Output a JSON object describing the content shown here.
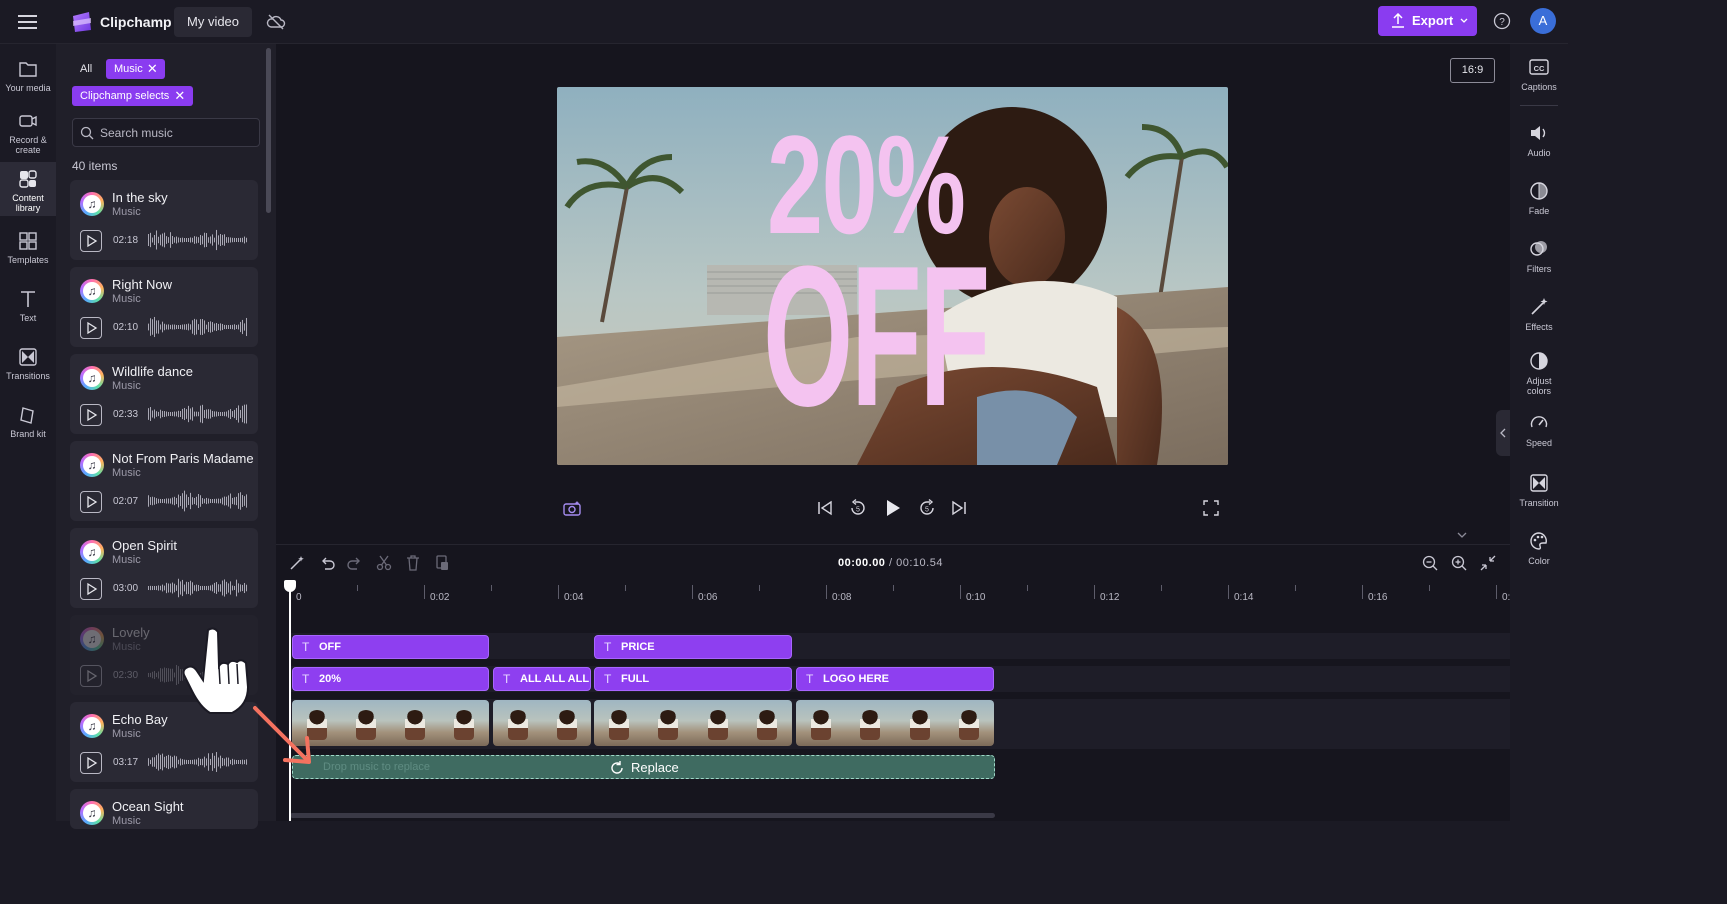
{
  "app": {
    "name": "Clipchamp",
    "project_title": "My video",
    "export_label": "Export",
    "avatar_initial": "A",
    "aspect_ratio": "16:9"
  },
  "left_rail": [
    {
      "label": "Your media",
      "icon": "folder-icon"
    },
    {
      "label": "Record & create",
      "icon": "camera-icon"
    },
    {
      "label": "Content library",
      "icon": "content-library-icon"
    },
    {
      "label": "Templates",
      "icon": "templates-icon"
    },
    {
      "label": "Text",
      "icon": "text-icon"
    },
    {
      "label": "Transitions",
      "icon": "transitions-icon"
    },
    {
      "label": "Brand kit",
      "icon": "brand-kit-icon"
    }
  ],
  "library": {
    "filters": {
      "all": "All",
      "music": "Music",
      "selects": "Clipchamp selects"
    },
    "search_placeholder": "Search music",
    "count": "40 items",
    "items": [
      {
        "title": "In the sky",
        "type": "Music",
        "duration": "02:18"
      },
      {
        "title": "Right Now",
        "type": "Music",
        "duration": "02:10"
      },
      {
        "title": "Wildlife dance",
        "type": "Music",
        "duration": "02:33"
      },
      {
        "title": "Not From Paris Madame",
        "type": "Music",
        "duration": "02:07"
      },
      {
        "title": "Open Spirit",
        "type": "Music",
        "duration": "03:00"
      },
      {
        "title": "Lovely",
        "type": "Music",
        "duration": "02:30"
      },
      {
        "title": "Echo Bay",
        "type": "Music",
        "duration": "03:17"
      },
      {
        "title": "Ocean Sight",
        "type": "Music",
        "duration": ""
      }
    ]
  },
  "preview": {
    "overlay_line1": "20%",
    "overlay_line2": "OFF"
  },
  "timeline": {
    "current_time": "00:00.00",
    "total_time": "/ 00:10.54",
    "ruler": [
      "0",
      "0:02",
      "0:04",
      "0:06",
      "0:08",
      "0:10",
      "0:12",
      "0:14",
      "0:16",
      "0:1"
    ],
    "text_clips_row1": [
      "OFF",
      "PRICE"
    ],
    "text_clips_row2": [
      "20%",
      "ALL ALL ALL A",
      "FULL",
      "LOGO HERE"
    ],
    "audio_drop_label": "Replace",
    "audio_ghost_text": "Drop music to replace"
  },
  "right_rail": [
    {
      "label": "Captions",
      "icon": "captions-icon"
    },
    {
      "label": "Audio",
      "icon": "speaker-icon"
    },
    {
      "label": "Fade",
      "icon": "fade-icon"
    },
    {
      "label": "Filters",
      "icon": "filters-icon"
    },
    {
      "label": "Effects",
      "icon": "effects-wand-icon"
    },
    {
      "label": "Adjust colors",
      "icon": "adjust-colors-icon"
    },
    {
      "label": "Speed",
      "icon": "speed-icon"
    },
    {
      "label": "Transition",
      "icon": "transition-icon"
    },
    {
      "label": "Color",
      "icon": "color-palette-icon"
    }
  ],
  "colors": {
    "accent": "#8e3ff0",
    "accent_light": "#a865ff",
    "audio_clip": "#3f6b61",
    "overlay_text": "#f4c3f0"
  }
}
